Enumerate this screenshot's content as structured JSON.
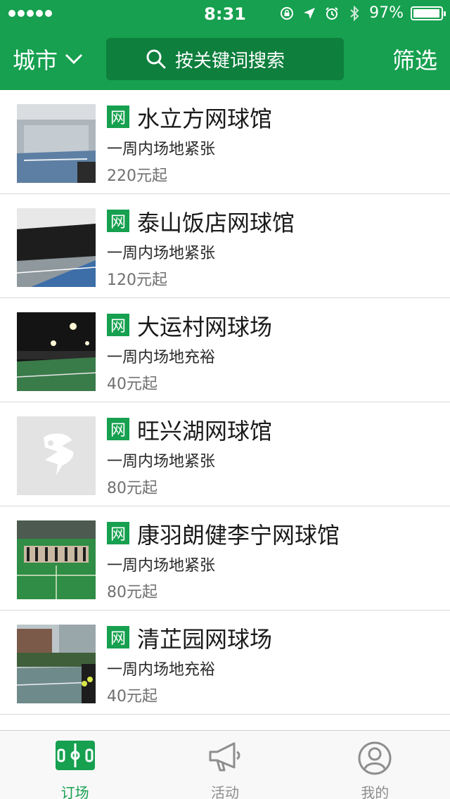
{
  "status_bar": {
    "time": "8:31",
    "battery_percent": "97%",
    "battery_level": 0.97
  },
  "header": {
    "city_label": "城市",
    "search_placeholder": "按关键词搜索",
    "filter_label": "筛选"
  },
  "venues": [
    {
      "badge": "网",
      "name": "水立方网球馆",
      "availability": "一周内场地紧张",
      "price": "220元起",
      "thumb": "indoor-court-photo"
    },
    {
      "badge": "网",
      "name": "泰山饭店网球馆",
      "availability": "一周内场地紧张",
      "price": "120元起",
      "thumb": "indoor-court-photo"
    },
    {
      "badge": "网",
      "name": "大运村网球场",
      "availability": "一周内场地充裕",
      "price": "40元起",
      "thumb": "night-court-photo"
    },
    {
      "badge": "网",
      "name": "旺兴湖网球馆",
      "availability": "一周内场地紧张",
      "price": "80元起",
      "thumb": "placeholder-logo"
    },
    {
      "badge": "网",
      "name": "康羽朗健李宁网球馆",
      "availability": "一周内场地紧张",
      "price": "80元起",
      "thumb": "group-photo"
    },
    {
      "badge": "网",
      "name": "清芷园网球场",
      "availability": "一周内场地充裕",
      "price": "40元起",
      "thumb": "outdoor-court-photo"
    }
  ],
  "tabbar": {
    "tabs": [
      {
        "label": "订场",
        "icon": "court-icon",
        "active": true
      },
      {
        "label": "活动",
        "icon": "megaphone-icon",
        "active": false
      },
      {
        "label": "我的",
        "icon": "user-icon",
        "active": false
      }
    ]
  },
  "colors": {
    "brand_green": "#16a04f",
    "search_bg": "#0e7f3d",
    "inactive_tab": "#8e8e8e"
  }
}
